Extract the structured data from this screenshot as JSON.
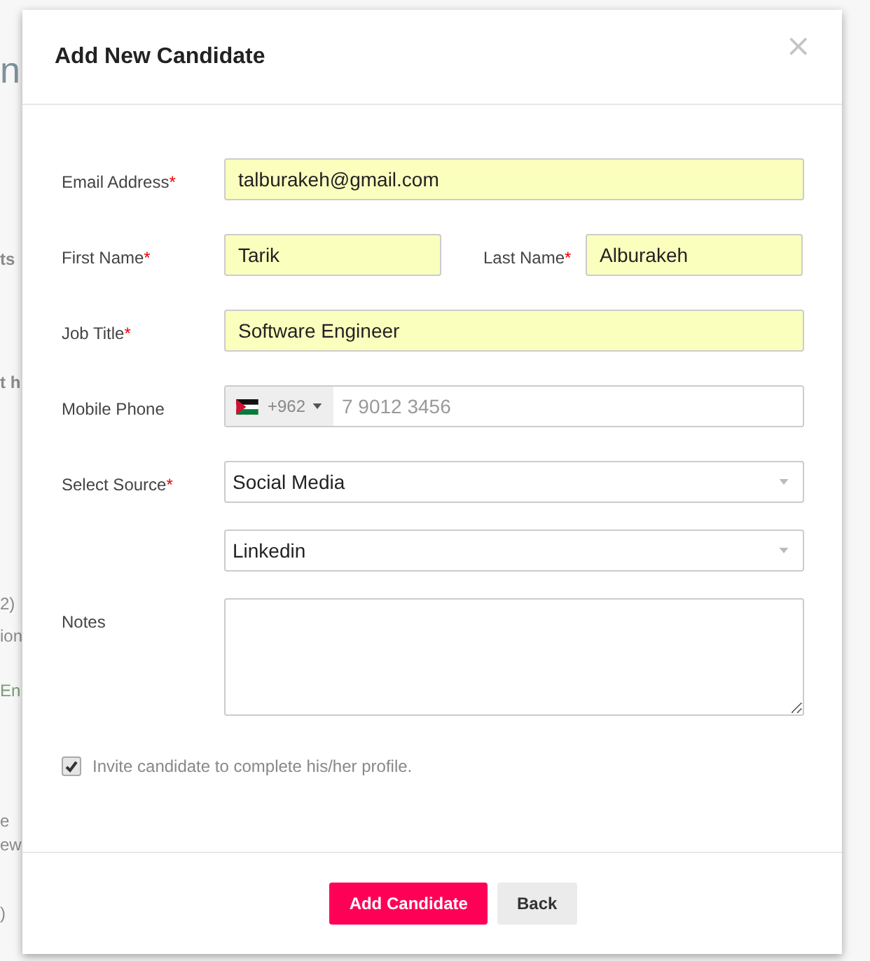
{
  "background": [
    {
      "text": "n",
      "kind": "heading"
    },
    {
      "text": "ts",
      "kind": "bold"
    },
    {
      "text": "t h",
      "kind": "bold"
    },
    {
      "text": "2)",
      "kind": "plain"
    },
    {
      "text": "ion",
      "kind": "plain"
    },
    {
      "text": "En",
      "kind": "link"
    },
    {
      "text": "e",
      "kind": "plain"
    },
    {
      "text": "ew",
      "kind": "plain"
    },
    {
      "text": ")",
      "kind": "plain"
    }
  ],
  "modal": {
    "title": "Add New Candidate",
    "close": "×",
    "fields": [
      {
        "kind": "text",
        "label": "Email Address",
        "required_mark": "*",
        "value": "talburakeh@gmail.com",
        "highlighted": true
      },
      {
        "kind": "pair",
        "items": [
          {
            "label": "First Name",
            "required_mark": "*",
            "value": "Tarik",
            "highlighted": true
          },
          {
            "label": "Last Name",
            "required_mark": "*",
            "value": "Alburakeh",
            "highlighted": true
          }
        ]
      },
      {
        "kind": "text",
        "label": "Job Title",
        "required_mark": "*",
        "value": "Software Engineer",
        "highlighted": true
      },
      {
        "kind": "phone",
        "label": "Mobile Phone",
        "code": "+962",
        "placeholder": "7 9012 3456"
      },
      {
        "kind": "select",
        "label": "Select Source",
        "required_mark": "*",
        "value": "Social Media"
      },
      {
        "kind": "select",
        "value": "Linkedin"
      },
      {
        "kind": "textarea",
        "label": "Notes"
      }
    ],
    "invite": {
      "label": "Invite candidate to complete his/her profile.",
      "checked": true
    },
    "buttons": [
      {
        "label": "Add Candidate",
        "kind": "primary"
      },
      {
        "label": "Back",
        "kind": "secondary"
      }
    ]
  }
}
